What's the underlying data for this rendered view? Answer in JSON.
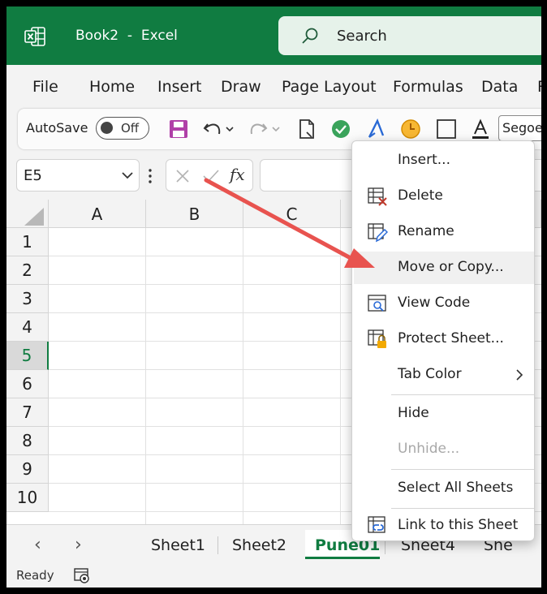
{
  "window": {
    "title": "Book2  -  Excel"
  },
  "search": {
    "label": "Search"
  },
  "menu": [
    "File",
    "Home",
    "Insert",
    "Draw",
    "Page Layout",
    "Formulas",
    "Data",
    "R"
  ],
  "qat": {
    "autosave_label": "AutoSave",
    "toggle_state": "Off",
    "font_value": "Segoe"
  },
  "formula_bar": {
    "cell_ref": "E5",
    "function_symbol": "fx"
  },
  "grid": {
    "columns": [
      "A",
      "B",
      "C"
    ],
    "rows": [
      "1",
      "2",
      "3",
      "4",
      "5",
      "6",
      "7",
      "8",
      "9",
      "10"
    ],
    "active_row": "5"
  },
  "sheets": {
    "tabs": [
      "Sheet1",
      "Sheet2",
      "Pune01",
      "Sheet4",
      "She"
    ],
    "active": "Pune01",
    "prev_arrow": "‹",
    "next_arrow": "›"
  },
  "status": {
    "text": "Ready"
  },
  "context_menu": {
    "items": [
      {
        "label": "Insert...",
        "icon": "none"
      },
      {
        "label": "Delete",
        "icon": "delete-sheet-icon"
      },
      {
        "label": "Rename",
        "icon": "rename-sheet-icon"
      },
      {
        "label": "Move or Copy...",
        "icon": "none",
        "highlighted": true
      },
      {
        "label": "View Code",
        "icon": "view-code-icon"
      },
      {
        "label": "Protect Sheet...",
        "icon": "protect-sheet-icon"
      },
      {
        "label": "Tab Color",
        "icon": "none",
        "submenu": true
      },
      {
        "label": "Hide",
        "icon": "none"
      },
      {
        "label": "Unhide...",
        "icon": "none",
        "disabled": true
      },
      {
        "label": "Select All Sheets",
        "icon": "none"
      },
      {
        "label": "Link to this Sheet",
        "icon": "link-sheet-icon"
      }
    ]
  },
  "colors": {
    "brand_green": "#107c41",
    "annotation_arrow": "#e8534f"
  }
}
